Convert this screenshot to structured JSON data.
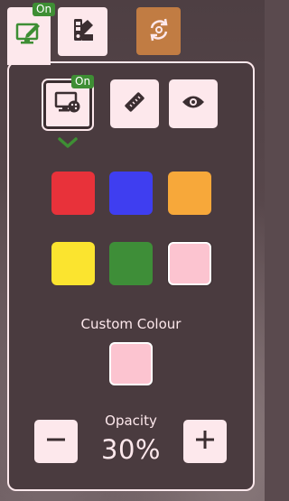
{
  "top_tabs": {
    "draw_on_badge": "On",
    "draw_icon": "screen-pen-icon",
    "palette_icon": "swatch-book-icon",
    "rotate_icon": "rotate-sync-icon"
  },
  "tools": {
    "overlay_on_badge": "On",
    "overlay_icon": "screen-palette-icon",
    "ruler_icon": "ruler-icon",
    "eye_icon": "eye-icon",
    "expand_icon": "chevron-down-icon"
  },
  "colors": {
    "swatches": [
      {
        "name": "red",
        "hex": "#e8323a"
      },
      {
        "name": "blue",
        "hex": "#3f3ef0"
      },
      {
        "name": "orange",
        "hex": "#f7a83a"
      },
      {
        "name": "yellow",
        "hex": "#fbe42f"
      },
      {
        "name": "green",
        "hex": "#3e8e38"
      },
      {
        "name": "pink",
        "hex": "#fcc4d0",
        "selected": true
      }
    ],
    "custom_label": "Custom Colour",
    "custom_hex": "#fcc4d0"
  },
  "opacity": {
    "label": "Opacity",
    "value": "30%",
    "fraction": 0.3
  },
  "theme": {
    "panel_bg": "#4a3b3f",
    "accent_light": "#fde8ec",
    "badge_green": "#3e8e34",
    "rotate_bg": "#c17c43"
  }
}
